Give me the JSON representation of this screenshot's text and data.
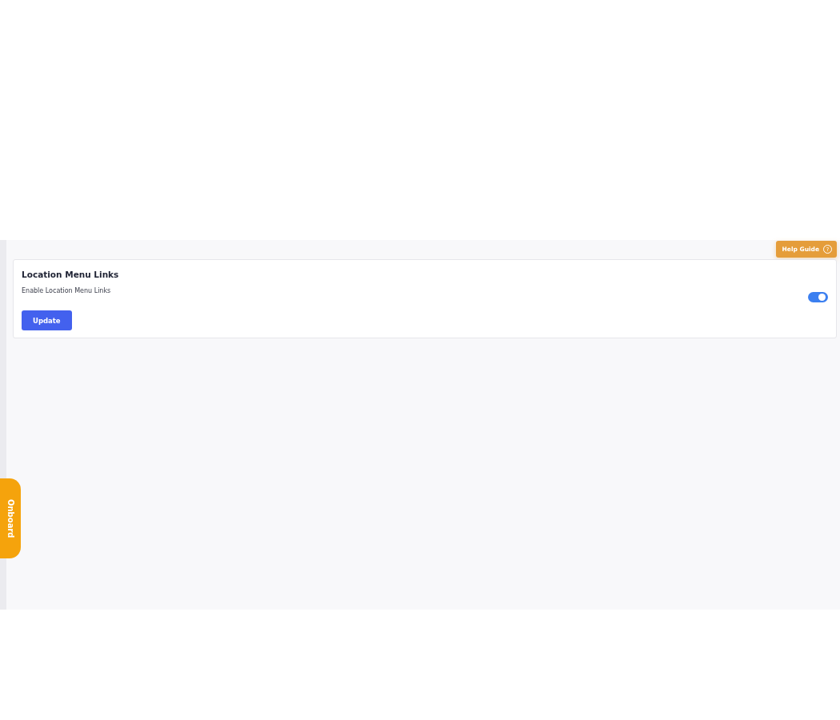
{
  "help_guide": {
    "label": "Help Guide",
    "icon": "?"
  },
  "card": {
    "title": "Location Menu Links",
    "setting": {
      "label": "Enable Location Menu Links",
      "on": true
    },
    "button": "Update"
  },
  "onboard_tab": {
    "label": "Onboard"
  }
}
